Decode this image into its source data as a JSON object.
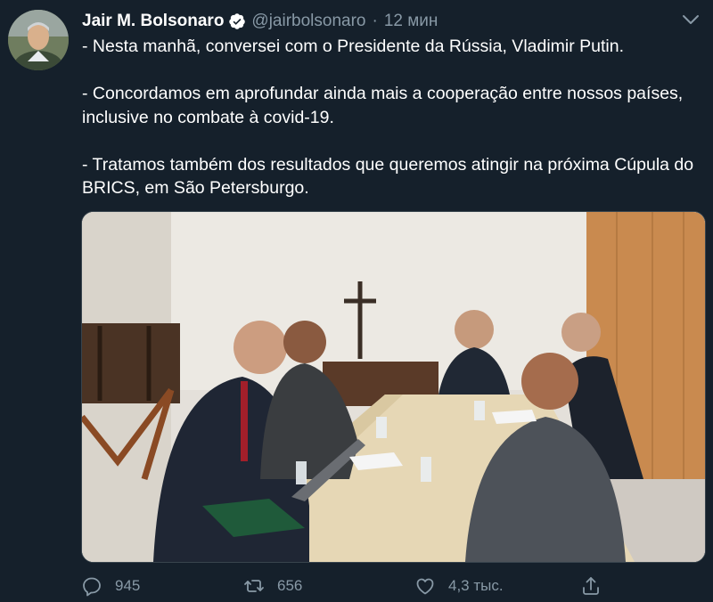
{
  "author": {
    "name": "Jair M. Bolsonaro",
    "handle": "@jairbolsonaro",
    "separator": "·",
    "time": "12 мин"
  },
  "tweet": {
    "paragraphs": [
      "- Nesta manhã, conversei com o Presidente da Rússia, Vladimir Putin.",
      "- Concordamos em aprofundar ainda mais a cooperação entre nossos países, inclusive no combate à covid-19.",
      "- Tratamos também dos resultados que queremos atingir na próxima Cúpula do BRICS, em São Petersburgo."
    ]
  },
  "actions": {
    "reply_count": "945",
    "retweet_count": "656",
    "like_count": "4,3 тыс.",
    "share_count": ""
  },
  "icons": {
    "verified": "verified-badge-icon",
    "more": "chevron-down-icon",
    "reply": "reply-icon",
    "retweet": "retweet-icon",
    "like": "heart-icon",
    "share": "share-icon"
  },
  "colors": {
    "background": "#15202b",
    "muted": "#8899a6",
    "verified": "#ffffff"
  }
}
